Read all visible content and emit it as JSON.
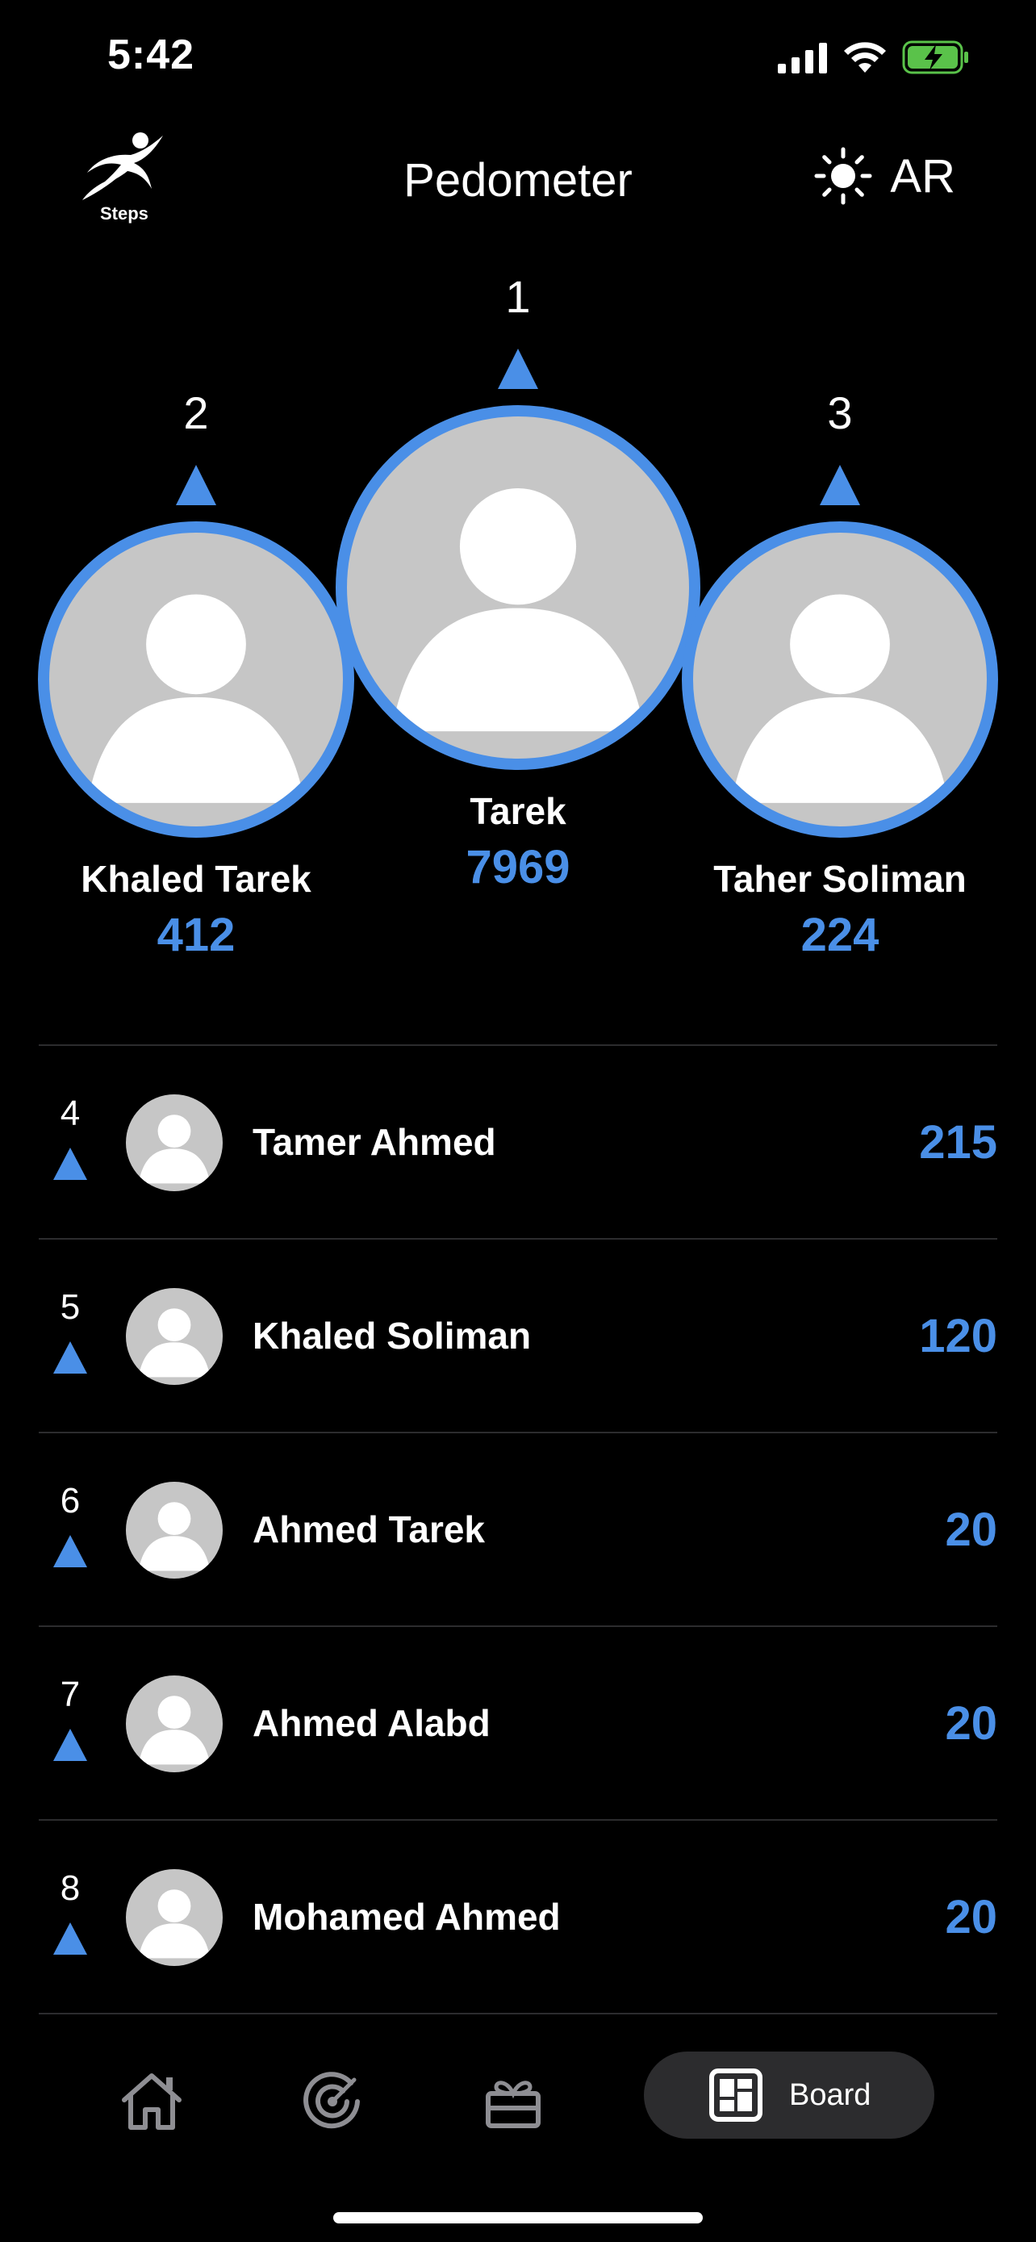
{
  "status_bar": {
    "time": "5:42"
  },
  "header": {
    "logo_text": "Steps",
    "title": "Pedometer",
    "language_label": "AR"
  },
  "podium": [
    {
      "rank": "2",
      "name": "Khaled Tarek",
      "score": "412"
    },
    {
      "rank": "1",
      "name": "Tarek",
      "score": "7969"
    },
    {
      "rank": "3",
      "name": "Taher Soliman",
      "score": "224"
    }
  ],
  "leaderboard": [
    {
      "rank": "4",
      "name": "Tamer Ahmed",
      "score": "215"
    },
    {
      "rank": "5",
      "name": "Khaled Soliman",
      "score": "120"
    },
    {
      "rank": "6",
      "name": "Ahmed Tarek",
      "score": "20"
    },
    {
      "rank": "7",
      "name": "Ahmed Alabd",
      "score": "20"
    },
    {
      "rank": "8",
      "name": "Mohamed Ahmed",
      "score": "20"
    }
  ],
  "tab_bar": {
    "tabs": [
      {
        "icon": "home-icon"
      },
      {
        "icon": "target-icon"
      },
      {
        "icon": "gift-icon"
      },
      {
        "icon": "board-icon",
        "label": "Board"
      }
    ]
  },
  "colors": {
    "accent": "#4a8fe7",
    "background": "#000000",
    "avatar_bg": "#c6c6c6",
    "divider": "#2c2c2e",
    "battery": "#5ac24a"
  }
}
